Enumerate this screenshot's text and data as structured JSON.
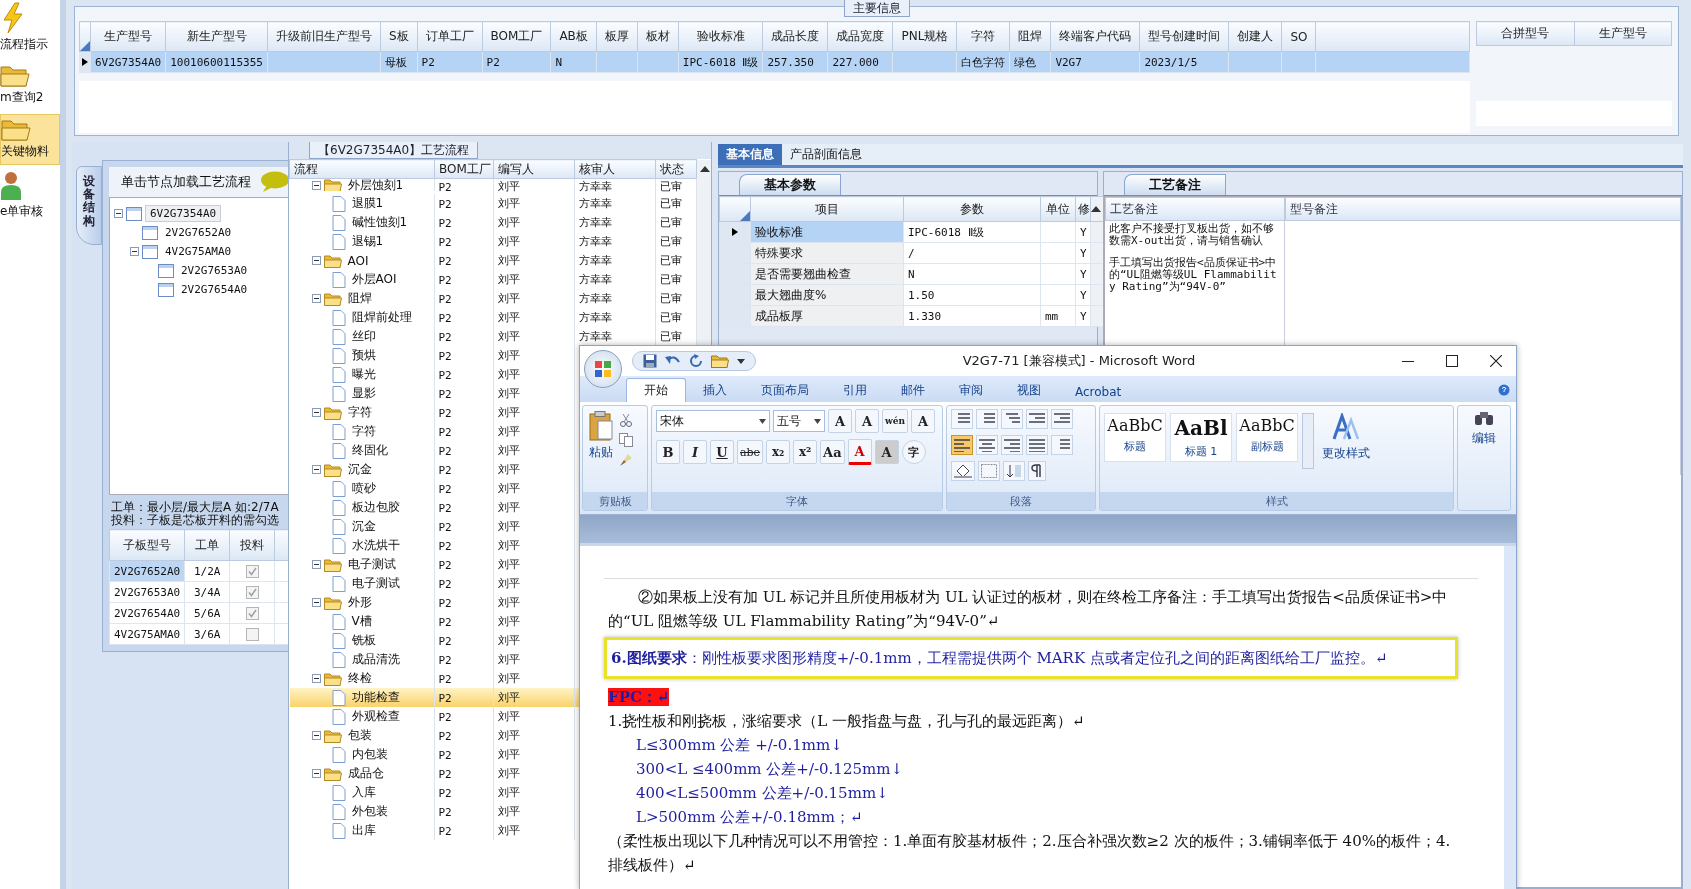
{
  "sidebar": {
    "items": [
      {
        "label": "流程指示",
        "kind": "bolt",
        "selected": false
      },
      {
        "label": "m查询2",
        "kind": "folder",
        "selected": false
      },
      {
        "label": "关键物料",
        "kind": "folder",
        "selected": true
      },
      {
        "label": "e单审核",
        "kind": "person",
        "selected": false
      }
    ]
  },
  "main_info": {
    "title": "主要信息",
    "columns": [
      "生产型号",
      "新生产型号",
      "升级前旧生产型号",
      "S板",
      "订单工厂",
      "BOM工厂",
      "AB板",
      "板厚",
      "板材",
      "验收标准",
      "成品长度",
      "成品宽度",
      "PNL规格",
      "字符",
      "阻焊",
      "终端客户代码",
      "型号创建时间",
      "创建人",
      "SO"
    ],
    "rows": [
      {
        "selected": true,
        "cells": [
          "6V2G7354A0",
          "10010600115355",
          null,
          "母板",
          "P2",
          "P2",
          "N",
          null,
          null,
          "IPC-6018 Ⅱ级",
          "257.350",
          "227.000",
          null,
          "白色字符",
          "绿色",
          "V2G7",
          "2023/1/5",
          null,
          null
        ]
      }
    ],
    "side_columns": [
      "合拼型号",
      "生产型号"
    ]
  },
  "device_structure": {
    "tab": "设备结构",
    "header": "单击节点加载工艺流程",
    "tree": [
      {
        "label": "6V2G7354A0",
        "selected": true,
        "expanded": true,
        "children": [
          {
            "label": "2V2G7652A0",
            "selected": false
          },
          {
            "label": "4V2G75AMA0",
            "selected": false,
            "expanded": true,
            "children": [
              {
                "label": "2V2G7653A0",
                "selected": false
              },
              {
                "label": "2V2G7654A0",
                "selected": false
              }
            ]
          }
        ]
      }
    ],
    "notes": [
      "工单：最小层/最大层A 如:2/7A",
      "投料：子板是芯板开料的需勾选"
    ],
    "sub_table": {
      "columns": [
        "子板型号",
        "工单",
        "投料"
      ],
      "rows": [
        {
          "board": "2V2G7652A0",
          "work_order": "1/2A",
          "checked": true,
          "selected": true
        },
        {
          "board": "2V2G7653A0",
          "work_order": "3/4A",
          "checked": true,
          "selected": false
        },
        {
          "board": "2V2G7654A0",
          "work_order": "5/6A",
          "checked": true,
          "selected": false
        },
        {
          "board": "4V2G75AMA0",
          "work_order": "3/6A",
          "checked": false,
          "selected": false
        }
      ]
    }
  },
  "process_flow": {
    "title": "【6V2G7354A0】工艺流程",
    "columns": [
      "流程",
      "BOM工厂",
      "编写人",
      "核审人",
      "状态"
    ],
    "steps": [
      {
        "name": "外层蚀刻1",
        "factory": "P2",
        "writer": "刘平",
        "reviewer": "方幸幸",
        "status": "已审",
        "expanded": true,
        "selected": false,
        "children": [
          {
            "name": "退膜1",
            "factory": "P2",
            "writer": "刘平",
            "reviewer": "方幸幸",
            "status": "已审",
            "selected": false
          },
          {
            "name": "碱性蚀刻1",
            "factory": "P2",
            "writer": "刘平",
            "reviewer": "方幸幸",
            "status": "已审",
            "selected": false
          },
          {
            "name": "退锡1",
            "factory": "P2",
            "writer": "刘平",
            "reviewer": "方幸幸",
            "status": "已审",
            "selected": false
          }
        ]
      },
      {
        "name": "AOI",
        "factory": "P2",
        "writer": "刘平",
        "reviewer": "方幸幸",
        "status": "已审",
        "expanded": true,
        "selected": false,
        "children": [
          {
            "name": "外层AOI",
            "factory": "P2",
            "writer": "刘平",
            "reviewer": "方幸幸",
            "status": "已审",
            "selected": false
          }
        ]
      },
      {
        "name": "阻焊",
        "factory": "P2",
        "writer": "刘平",
        "reviewer": "方幸幸",
        "status": "已审",
        "expanded": true,
        "selected": false,
        "children": [
          {
            "name": "阻焊前处理",
            "factory": "P2",
            "writer": "刘平",
            "reviewer": "方幸幸",
            "status": "已审",
            "selected": false
          },
          {
            "name": "丝印",
            "factory": "P2",
            "writer": "刘平",
            "reviewer": "方幸幸",
            "status": "已审",
            "selected": false
          },
          {
            "name": "预烘",
            "factory": "P2",
            "writer": "刘平",
            "selected": false
          },
          {
            "name": "曝光",
            "factory": "P2",
            "writer": "刘平",
            "selected": false
          },
          {
            "name": "显影",
            "factory": "P2",
            "writer": "刘平",
            "selected": false
          }
        ]
      },
      {
        "name": "字符",
        "factory": "P2",
        "writer": "刘平",
        "expanded": true,
        "selected": false,
        "children": [
          {
            "name": "字符",
            "factory": "P2",
            "writer": "刘平",
            "selected": false
          },
          {
            "name": "终固化",
            "factory": "P2",
            "writer": "刘平",
            "selected": false
          }
        ]
      },
      {
        "name": "沉金",
        "factory": "P2",
        "writer": "刘平",
        "expanded": true,
        "selected": false,
        "children": [
          {
            "name": "喷砂",
            "factory": "P2",
            "writer": "刘平",
            "selected": false
          },
          {
            "name": "板边包胶",
            "factory": "P2",
            "writer": "刘平",
            "selected": false
          },
          {
            "name": "沉金",
            "factory": "P2",
            "writer": "刘平",
            "selected": false
          },
          {
            "name": "水洗烘干",
            "factory": "P2",
            "writer": "刘平",
            "selected": false
          }
        ]
      },
      {
        "name": "电子测试",
        "factory": "P2",
        "writer": "刘平",
        "expanded": true,
        "selected": false,
        "children": [
          {
            "name": "电子测试",
            "factory": "P2",
            "writer": "刘平",
            "selected": false
          }
        ]
      },
      {
        "name": "外形",
        "factory": "P2",
        "writer": "刘平",
        "expanded": true,
        "selected": false,
        "children": [
          {
            "name": "V槽",
            "factory": "P2",
            "writer": "刘平",
            "selected": false
          },
          {
            "name": "铣板",
            "factory": "P2",
            "writer": "刘平",
            "selected": false
          },
          {
            "name": "成品清洗",
            "factory": "P2",
            "writer": "刘平",
            "selected": false
          }
        ]
      },
      {
        "name": "终检",
        "factory": "P2",
        "writer": "刘平",
        "expanded": true,
        "selected": false,
        "children": [
          {
            "name": "功能检查",
            "factory": "P2",
            "writer": "刘平",
            "selected": true
          },
          {
            "name": "外观检查",
            "factory": "P2",
            "writer": "刘平",
            "selected": false
          }
        ]
      },
      {
        "name": "包装",
        "factory": "P2",
        "writer": "刘平",
        "expanded": true,
        "selected": false,
        "children": [
          {
            "name": "内包装",
            "factory": "P2",
            "writer": "刘平",
            "selected": false
          }
        ]
      },
      {
        "name": "成品仓",
        "factory": "P2",
        "writer": "刘平",
        "expanded": true,
        "selected": false,
        "children": [
          {
            "name": "入库",
            "factory": "P2",
            "writer": "刘平",
            "selected": false
          },
          {
            "name": "外包装",
            "factory": "P2",
            "writer": "刘平",
            "selected": false
          },
          {
            "name": "出库",
            "factory": "P2",
            "writer": "刘平",
            "selected": false
          }
        ]
      }
    ]
  },
  "details": {
    "tabs": [
      {
        "label": "基本信息",
        "selected": true
      },
      {
        "label": "产品剖面信息",
        "selected": false
      }
    ],
    "params": {
      "tab": "基本参数",
      "columns": [
        "项目",
        "参数",
        "单位",
        "修"
      ],
      "rows": [
        {
          "item": "验收标准",
          "value": "IPC-6018 Ⅱ级",
          "unit": null,
          "flag": "Y",
          "selected": true
        },
        {
          "item": "特殊要求",
          "value": "/",
          "unit": null,
          "flag": "Y",
          "selected": false
        },
        {
          "item": "是否需要翘曲检查",
          "value": "N",
          "unit": null,
          "flag": "Y",
          "selected": false
        },
        {
          "item": "最大翘曲度%",
          "value": "1.50",
          "unit": null,
          "flag": "Y",
          "selected": false
        },
        {
          "item": "成品板厚",
          "value": "1.330",
          "unit": "mm",
          "flag": "Y",
          "selected": false
        }
      ]
    },
    "remarks": {
      "tab": "工艺备注",
      "columns": [
        "工艺备注",
        "型号备注"
      ],
      "process_note": [
        "此客户不接受打叉板出货，如不够数需X-out出货，请与销售确认",
        "手工填写出货报告<品质保证书>中的“UL阻燃等级UL Flammability Rating”为“94V-0”"
      ]
    }
  },
  "word_window": {
    "title": "V2G7-71 [兼容模式] - Microsoft Word",
    "ribbon_tabs": [
      {
        "label": "开始",
        "selected": true
      },
      {
        "label": "插入",
        "selected": false
      },
      {
        "label": "页面布局",
        "selected": false
      },
      {
        "label": "引用",
        "selected": false
      },
      {
        "label": "邮件",
        "selected": false
      },
      {
        "label": "审阅",
        "selected": false
      },
      {
        "label": "视图",
        "selected": false
      },
      {
        "label": "Acrobat",
        "selected": false
      }
    ],
    "paste": "粘贴",
    "font_name": "宋体",
    "font_size": "五号",
    "font_row1": [
      "A",
      "A",
      "wén",
      "A"
    ],
    "font_row2": [
      "B",
      "I",
      "U",
      "abe",
      "x₂",
      "x²",
      "Aa",
      "A",
      "A",
      "字"
    ],
    "alignments": [
      {
        "kind": "left",
        "selected": true
      },
      {
        "kind": "center",
        "selected": false
      },
      {
        "kind": "right",
        "selected": false
      },
      {
        "kind": "justify",
        "selected": false
      }
    ],
    "styles": [
      {
        "preview": "AaBbC",
        "label": "标题"
      },
      {
        "preview": "AaBl",
        "label": "标题 1"
      },
      {
        "preview": "AaBbC",
        "label": "副标题"
      }
    ],
    "change_styles": "更改样式",
    "edit": "编辑",
    "groups": [
      "剪贴板",
      "字体",
      "段落",
      "样式"
    ],
    "document": [
      {
        "kind": "body",
        "text": "②如果板上没有加 UL 标记并且所使用板材为 UL 认证过的板材，则在终检工序备注：手工填写出货报告<品质保证书>中的“UL 阻燃等级 UL Flammability Rating”为“94V-0”↵"
      },
      {
        "kind": "boxed",
        "text": "**6.图纸要求**：刚性板要求图形精度+/-0.1mm，工程需提供两个 MARK 点或者定位孔之间的距离图纸给工厂监控。↵"
      },
      {
        "kind": "highlight",
        "text": "FPC：↵"
      },
      {
        "kind": "heading",
        "text": "1.挠性板和刚挠板，涨缩要求（L 一般指盘与盘，孔与孔的最远距离）↵"
      },
      {
        "kind": "measure",
        "text": "L≤300mm 公差 +/-0.1mm↓"
      },
      {
        "kind": "measure",
        "text": "300<L ≤400mm 公差+/-0.125mm↓"
      },
      {
        "kind": "measure",
        "text": "400<L≤500mm 公差+/-0.15mm↓"
      },
      {
        "kind": "measure",
        "text": "L>500mm 公差+/-0.18mm；↵"
      },
      {
        "kind": "heading",
        "text": "（柔性板出现以下几种情况可以不用管控：1.单面有胶基材板件；2.压合补强次数≥2 次的板件；3.铺铜率低于 40%的板件；4.排线板件）↵"
      }
    ]
  }
}
